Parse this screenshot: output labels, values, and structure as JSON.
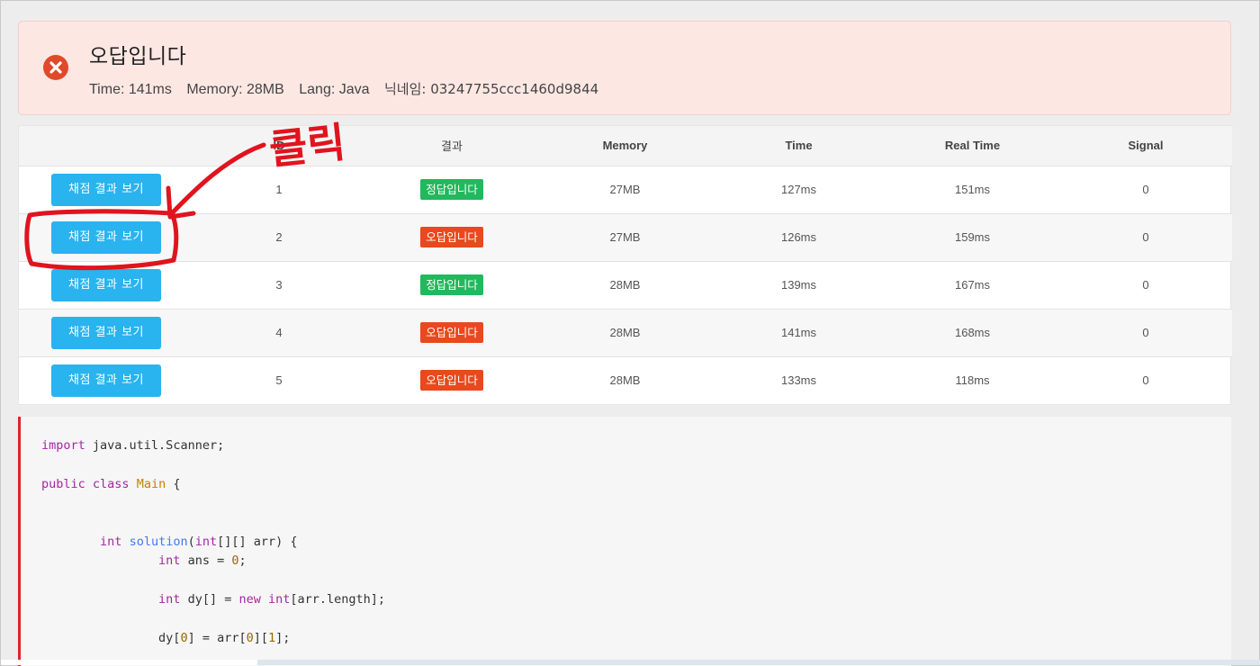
{
  "alert": {
    "title": "오답입니다",
    "time": "Time: 141ms",
    "memory": "Memory: 28MB",
    "lang": "Lang: Java",
    "nickname": "닉네임: 03247755ccc1460d9844"
  },
  "table": {
    "headers": [
      "",
      "ID",
      "결과",
      "Memory",
      "Time",
      "Real Time",
      "Signal"
    ],
    "rows": [
      {
        "button": "채점 결과 보기",
        "id": "1",
        "result": "정답입니다",
        "status": "ok",
        "memory": "27MB",
        "time": "127ms",
        "real_time": "151ms",
        "signal": "0"
      },
      {
        "button": "채점 결과 보기",
        "id": "2",
        "result": "오답입니다",
        "status": "fail",
        "memory": "27MB",
        "time": "126ms",
        "real_time": "159ms",
        "signal": "0"
      },
      {
        "button": "채점 결과 보기",
        "id": "3",
        "result": "정답입니다",
        "status": "ok",
        "memory": "28MB",
        "time": "139ms",
        "real_time": "167ms",
        "signal": "0"
      },
      {
        "button": "채점 결과 보기",
        "id": "4",
        "result": "오답입니다",
        "status": "fail",
        "memory": "28MB",
        "time": "141ms",
        "real_time": "168ms",
        "signal": "0"
      },
      {
        "button": "채점 결과 보기",
        "id": "5",
        "result": "오답입니다",
        "status": "fail",
        "memory": "28MB",
        "time": "133ms",
        "real_time": "118ms",
        "signal": "0"
      }
    ]
  },
  "code": {
    "line1_kw": "import",
    "line1_rest": " java.util.Scanner;",
    "line2_kw1": "public",
    "line2_kw2": "class",
    "line2_cls": "Main",
    "line2_rest": " {",
    "line3_type": "int",
    "line3_fn": "solution",
    "line3_p1": "(",
    "line3_type2": "int",
    "line3_rest": "[][] arr) {",
    "line4_type": "int",
    "line4_rest1": " ans = ",
    "line4_num": "0",
    "line4_rest2": ";",
    "line5_type": "int",
    "line5_rest1": " dy[] = ",
    "line5_kw": "new",
    "line5_type2": "int",
    "line5_rest2": "[arr.length];",
    "line6_a": "dy[",
    "line6_n1": "0",
    "line6_b": "] = arr[",
    "line6_n2": "0",
    "line6_c": "][",
    "line6_n3": "1",
    "line6_d": "];"
  },
  "annotation": {
    "text": "클릭",
    "color": "#e0141e"
  },
  "colors": {
    "alert_bg": "#fde7e3",
    "error_icon": "#e0492a",
    "button": "#29b3ef",
    "badge_ok": "#22b85d",
    "badge_fail": "#e8491d",
    "code_border": "#d9252d"
  },
  "icons": {
    "alert": "close-circle-icon"
  }
}
